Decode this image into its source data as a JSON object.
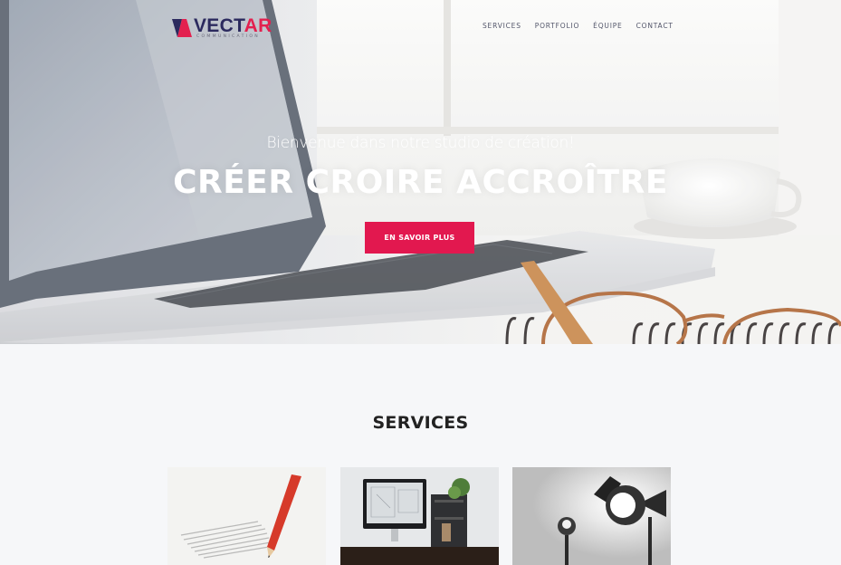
{
  "brand": {
    "name_part1": "VECT",
    "name_part2": "AR",
    "tagline": "COMMUNICATION"
  },
  "nav": {
    "items": [
      {
        "label": "SERVICES"
      },
      {
        "label": "PORTFOLIO"
      },
      {
        "label": "ÉQUIPE"
      },
      {
        "label": "CONTACT"
      }
    ]
  },
  "hero": {
    "subtitle": "Bienvenue dans notre studio de création!",
    "title": "CRÉER CROIRE ACCROÎTRE",
    "cta_label": "EN SAVOIR PLUS"
  },
  "services": {
    "heading": "SERVICES",
    "cards": [
      {
        "image": "pencil-drawing-image"
      },
      {
        "image": "desk-workspace-image"
      },
      {
        "image": "studio-light-image"
      }
    ]
  },
  "colors": {
    "accent": "#e2184f",
    "brand_dark": "#2b2a5e",
    "page_bg": "#f6f7f9"
  }
}
